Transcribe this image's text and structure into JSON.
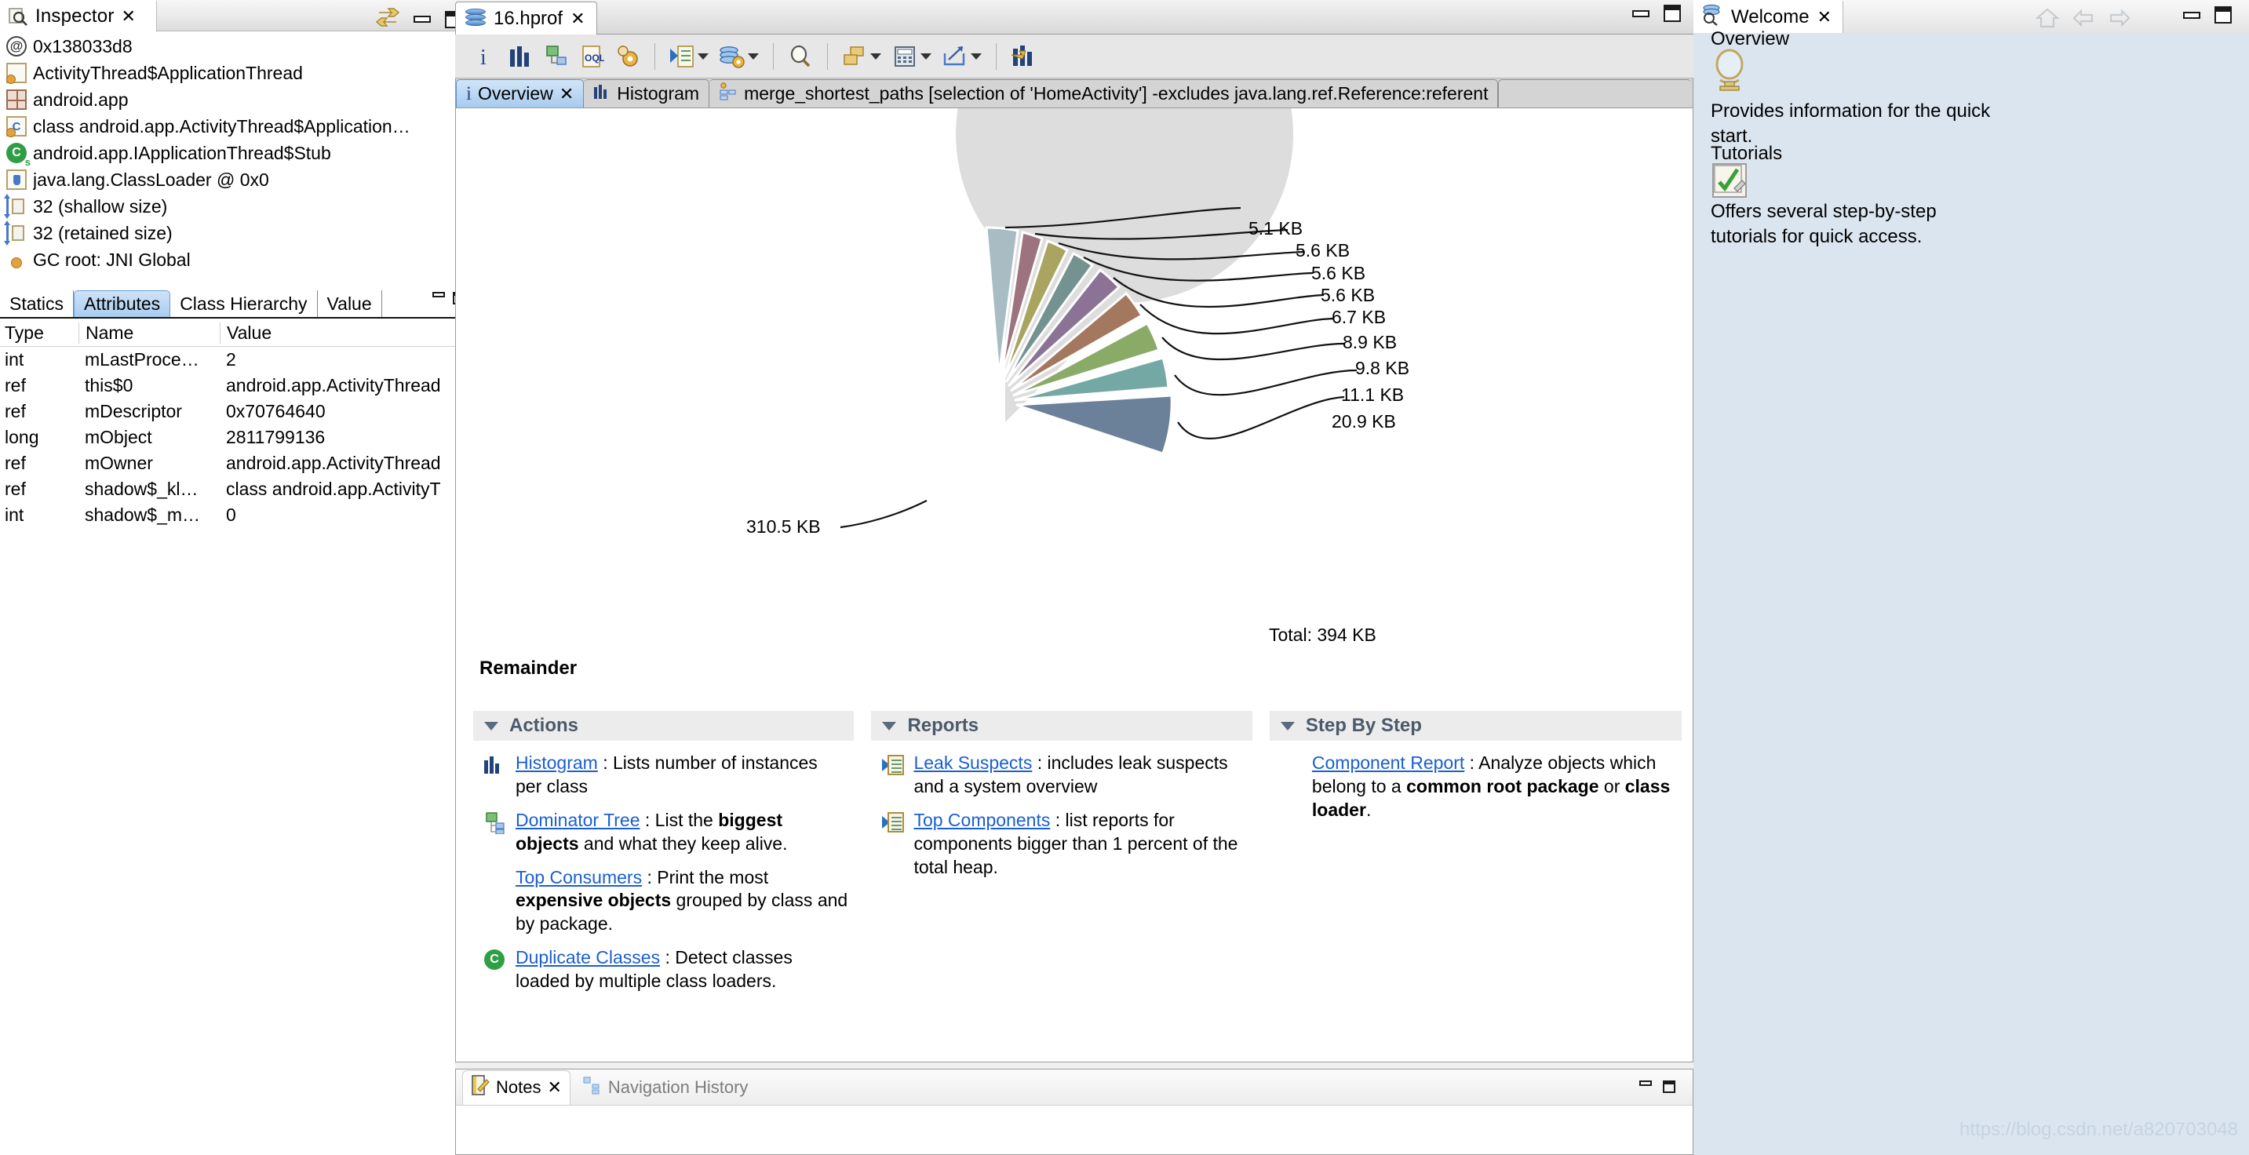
{
  "inspector": {
    "title": "Inspector",
    "close": "✕",
    "items": [
      {
        "icon": "at-sign-icon",
        "label": "0x138033d8"
      },
      {
        "icon": "object-doc-icon",
        "label": "ActivityThread$ApplicationThread"
      },
      {
        "icon": "package-grid-icon",
        "label": "android.app"
      },
      {
        "icon": "class-doc-icon",
        "label": "class android.app.ActivityThread$Application…"
      },
      {
        "icon": "green-class-icon",
        "label": "android.app.IApplicationThread$Stub"
      },
      {
        "icon": "classloader-icon",
        "label": "java.lang.ClassLoader @ 0x0"
      },
      {
        "icon": "shallow-size-icon",
        "label": "32 (shallow size)"
      },
      {
        "icon": "retained-size-icon",
        "label": "32 (retained size)"
      },
      {
        "icon": "gc-root-icon",
        "label": "GC root: JNI Global"
      }
    ],
    "tabs": [
      {
        "label": "Statics",
        "active": false
      },
      {
        "label": "Attributes",
        "active": true
      },
      {
        "label": "Class Hierarchy",
        "active": false
      },
      {
        "label": "Value",
        "active": false
      }
    ],
    "table": {
      "columns": [
        "Type",
        "Name",
        "Value"
      ],
      "rows": [
        [
          "int",
          "mLastProce…",
          "2"
        ],
        [
          "ref",
          "this$0",
          "android.app.ActivityThread"
        ],
        [
          "ref",
          "mDescriptor",
          "0x70764640"
        ],
        [
          "long",
          "mObject",
          "2811799136"
        ],
        [
          "ref",
          "mOwner",
          "android.app.ActivityThread"
        ],
        [
          "ref",
          "shadow$_kl…",
          "class android.app.ActivityT"
        ],
        [
          "int",
          "shadow$_m…",
          "0"
        ]
      ]
    }
  },
  "editor": {
    "file_tab": {
      "label": "16.hprof",
      "close": "✕",
      "icon": "heap-dump-icon"
    },
    "toolbar": [
      {
        "name": "info-icon",
        "glyph": "i"
      },
      {
        "name": "histogram-icon",
        "glyph": "bars"
      },
      {
        "name": "dominator-tree-icon",
        "glyph": "tree"
      },
      {
        "name": "oql-icon",
        "glyph": "oql"
      },
      {
        "name": "calculate-retained-icon",
        "glyph": "gears"
      },
      {
        "name": "open-query-browser-icon",
        "glyph": "list-run",
        "dropdown": true
      },
      {
        "name": "heap-actions-icon",
        "glyph": "db-gear",
        "dropdown": true
      },
      {
        "name": "find-icon",
        "glyph": "magnifier"
      },
      {
        "name": "group-by-icon",
        "glyph": "squares",
        "dropdown": true
      },
      {
        "name": "calculator-icon",
        "glyph": "calc",
        "dropdown": true
      },
      {
        "name": "export-icon",
        "glyph": "export",
        "dropdown": true
      },
      {
        "name": "compare-icon",
        "glyph": "compare-bars"
      }
    ],
    "inner_tabs": [
      {
        "label": "Overview",
        "icon": "info-icon",
        "active": true
      },
      {
        "label": "Histogram",
        "icon": "histogram-icon",
        "active": false
      },
      {
        "label": "merge_shortest_paths  [selection of 'HomeActivity'] -excludes java.lang.ref.Reference:referent",
        "icon": "paths-icon",
        "active": false
      }
    ],
    "remainder_label": "Remainder",
    "sections": [
      {
        "title": "Actions",
        "items": [
          {
            "icon": "histogram-icon",
            "link": "Histogram",
            "rest": " : Lists number of instances per class"
          },
          {
            "icon": "dominator-tree-icon",
            "link": "Dominator Tree",
            "rest": " : List the  <b>biggest objects</b> and what they keep alive."
          },
          {
            "icon": "top-consumers-icon",
            "link": "Top Consumers",
            "rest": " : Print the most <b>expensive objects</b> grouped by class and by package."
          },
          {
            "icon": "duplicate-classes-icon",
            "link": "Duplicate Classes",
            "rest": " : Detect classes loaded by multiple class loaders."
          }
        ]
      },
      {
        "title": "Reports",
        "items": [
          {
            "icon": "report-icon",
            "link": "Leak Suspects",
            "rest": " : includes leak suspects and a system overview"
          },
          {
            "icon": "report-icon",
            "link": "Top Components",
            "rest": " : list reports for components bigger than 1 percent of the total heap."
          }
        ]
      },
      {
        "title": "Step By Step",
        "items": [
          {
            "icon": "none",
            "link": "Component Report",
            "rest": " : Analyze objects which belong to a <b>common root package</b> or <b>class loader</b>."
          }
        ]
      }
    ],
    "bottom_tabs": [
      {
        "label": "Notes",
        "icon": "notes-icon",
        "active": true,
        "close": "✕"
      },
      {
        "label": "Navigation History",
        "icon": "history-icon",
        "active": false
      }
    ]
  },
  "welcome": {
    "title": "Welcome",
    "close": "✕",
    "heading_overview": "Overview",
    "text_overview": "Provides information for the quick start.",
    "heading_tutorials": "Tutorials",
    "text_tutorials": "Offers several step-by-step tutorials for quick access.",
    "watermark": "https://blog.csdn.net/a820703048"
  },
  "chart_data": {
    "type": "pie",
    "title": "",
    "total_label": "Total: 394 KB",
    "unit": "KB",
    "labels": [
      "310.5 KB",
      "20.9 KB",
      "11.1 KB",
      "9.8 KB",
      "8.9 KB",
      "6.7 KB",
      "5.6 KB",
      "5.6 KB",
      "5.6 KB",
      "5.1 KB"
    ],
    "values": [
      310.5,
      20.9,
      11.1,
      9.8,
      8.9,
      6.7,
      5.6,
      5.6,
      5.6,
      5.1
    ],
    "colors": [
      "#dddddd",
      "#6a8199",
      "#74a8a4",
      "#8aab68",
      "#a4775f",
      "#8a7395",
      "#749290",
      "#a9a45f",
      "#9e7380",
      "#a8bcc4"
    ],
    "exploded": [
      false,
      true,
      true,
      true,
      true,
      true,
      true,
      true,
      true,
      true
    ],
    "legend": "none",
    "grid": false
  }
}
